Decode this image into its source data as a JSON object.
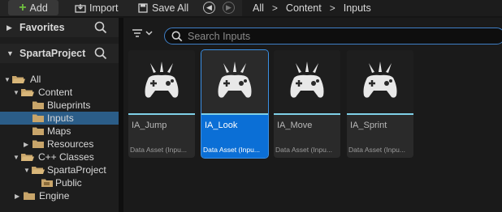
{
  "toolbar": {
    "add_label": "Add",
    "import_label": "Import",
    "save_all_label": "Save All"
  },
  "breadcrumb": [
    "All",
    "Content",
    "Inputs"
  ],
  "sidebar": {
    "favorites_label": "Favorites",
    "project_label": "SpartaProject",
    "tree": [
      {
        "label": "All"
      },
      {
        "label": "Content"
      },
      {
        "label": "Blueprints"
      },
      {
        "label": "Inputs",
        "selected": true
      },
      {
        "label": "Maps"
      },
      {
        "label": "Resources"
      },
      {
        "label": "C++ Classes"
      },
      {
        "label": "SpartaProject"
      },
      {
        "label": "Public"
      },
      {
        "label": "Engine"
      }
    ]
  },
  "search": {
    "placeholder": "Search Inputs"
  },
  "assets": [
    {
      "name": "IA_Jump",
      "type": "Data Asset (Inpu...",
      "selected": false
    },
    {
      "name": "IA_Look",
      "type": "Data Asset (Inpu...",
      "selected": true
    },
    {
      "name": "IA_Move",
      "type": "Data Asset (Inpu...",
      "selected": false
    },
    {
      "name": "IA_Sprint",
      "type": "Data Asset (Inpu...",
      "selected": false
    }
  ],
  "colors": {
    "accent": "#0b6fd6",
    "add_plus": "#6fbf3f",
    "asset_stripe": "#7fd0e8",
    "tree_selected": "#2b5d88"
  }
}
